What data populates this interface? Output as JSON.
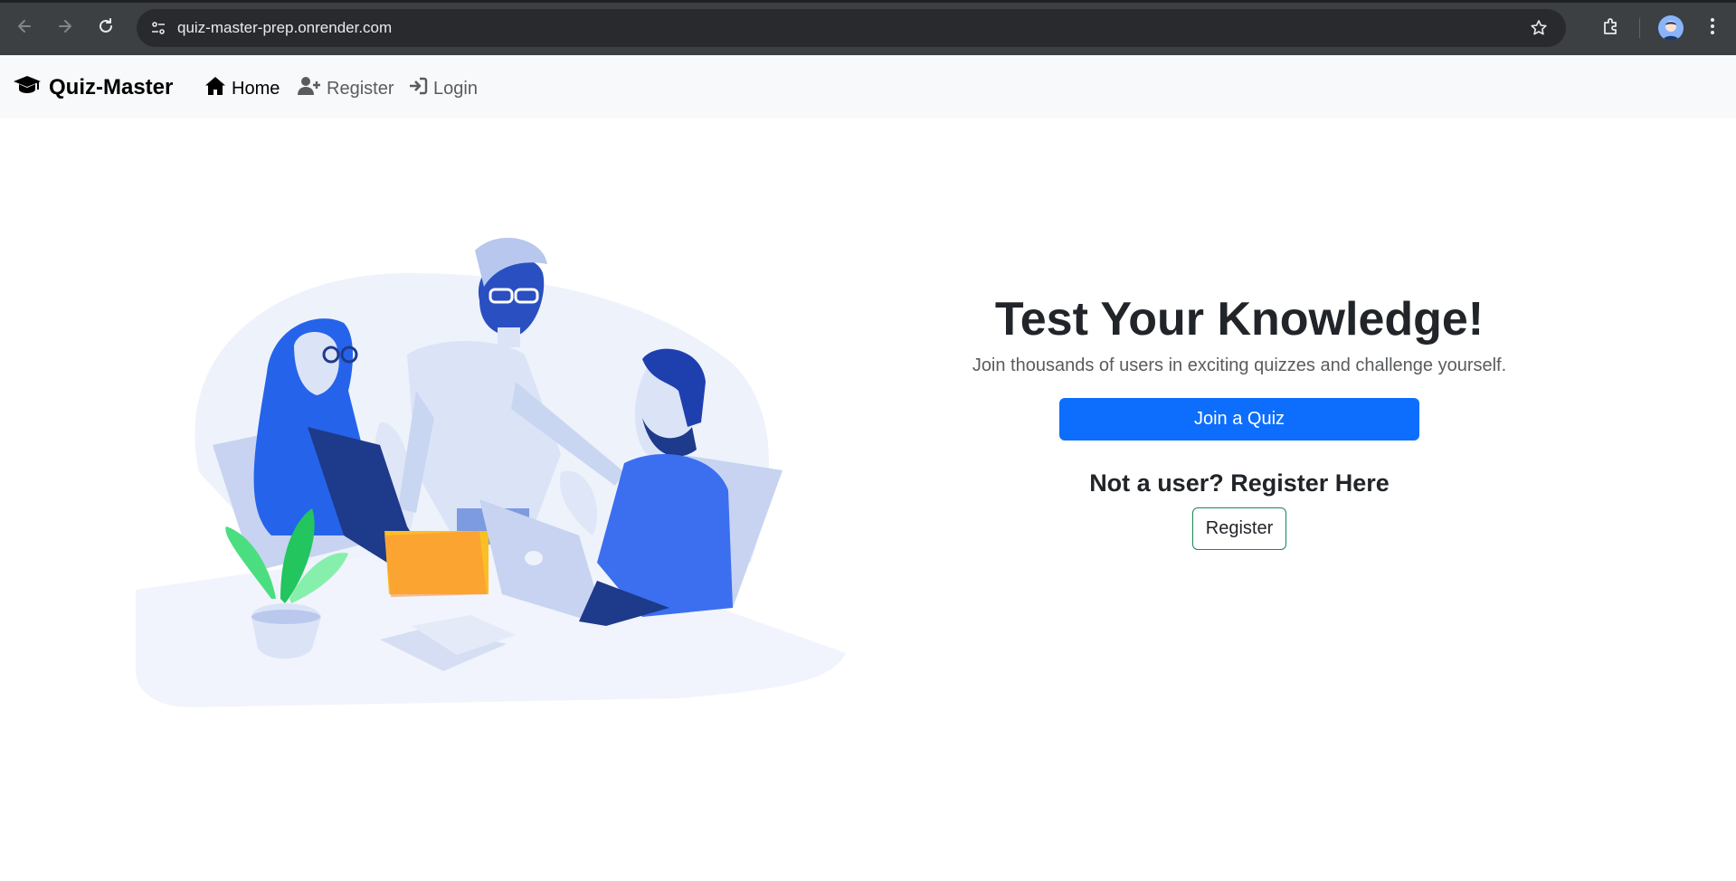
{
  "browser": {
    "url": "quiz-master-prep.onrender.com",
    "icons": [
      "back-arrow-icon",
      "forward-arrow-icon",
      "reload-icon",
      "site-info-icon",
      "bookmark-star-icon",
      "extensions-icon",
      "profile-avatar",
      "more-menu-icon"
    ]
  },
  "navbar": {
    "brand": "Quiz-Master",
    "brand_icon": "graduation-cap-icon",
    "links": [
      {
        "label": "Home",
        "icon": "home-icon",
        "active": true
      },
      {
        "label": "Register",
        "icon": "user-plus-icon",
        "active": false
      },
      {
        "label": "Login",
        "icon": "sign-in-icon",
        "active": false
      }
    ]
  },
  "hero": {
    "title": "Test Your Knowledge!",
    "subtitle": "Join thousands of users in exciting quizzes and challenge yourself.",
    "join_button": "Join a Quiz",
    "register_prompt": "Not a user? Register Here",
    "register_button": "Register"
  },
  "colors": {
    "primary": "#0d6efd",
    "success_outline": "#198754",
    "navbar_bg": "#f8f9fa",
    "chrome_bg": "#3c4043"
  }
}
